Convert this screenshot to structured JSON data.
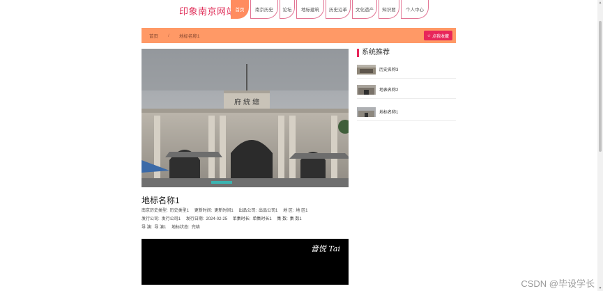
{
  "header": {
    "logo": "印象南京网站",
    "nav": [
      {
        "label": "首页",
        "active": true,
        "width": 26
      },
      {
        "label": "南京历史",
        "active": false,
        "width": 40
      },
      {
        "label": "论坛",
        "active": false,
        "width": 22
      },
      {
        "label": "地标建筑",
        "active": false,
        "width": 40
      },
      {
        "label": "历史沿革",
        "active": false,
        "width": 36
      },
      {
        "label": "文化遗产",
        "active": false,
        "width": 36
      },
      {
        "label": "知识要",
        "active": false,
        "width": 30
      },
      {
        "label": "个人中心",
        "active": false,
        "width": 40
      }
    ]
  },
  "breadcrumb": {
    "home": "首页",
    "separator": "/",
    "current": "地标名称1",
    "fav_button": "点我收藏"
  },
  "detail": {
    "title": "地标名称1",
    "meta_rows": [
      [
        {
          "k": "南京历史类型:",
          "v": "历史类型1"
        },
        {
          "k": "更新时间:",
          "v": "更新时间1"
        },
        {
          "k": "出品公司:",
          "v": "出品公司1"
        },
        {
          "k": "地 区:",
          "v": "地 区1"
        }
      ],
      [
        {
          "k": "发行公司:",
          "v": "发行公司1"
        },
        {
          "k": "发行日期:",
          "v": "2024-02-25"
        },
        {
          "k": "单集时长:",
          "v": "单集时长1"
        },
        {
          "k": "集 数:",
          "v": "集 数1"
        }
      ],
      [
        {
          "k": "导 演:",
          "v": "导 演1"
        },
        {
          "k": "地标状态:",
          "v": "完结"
        }
      ]
    ],
    "video_overlay": "音悦 Tai"
  },
  "sidebar": {
    "title": "系统推荐",
    "items": [
      {
        "label": "历史名称3"
      },
      {
        "label": "地表名称2"
      },
      {
        "label": "地标名称1"
      }
    ]
  },
  "watermark": "CSDN @毕设学长",
  "colors": {
    "brand": "#e0305a",
    "accent": "#ff9966",
    "button": "#e8265a"
  }
}
